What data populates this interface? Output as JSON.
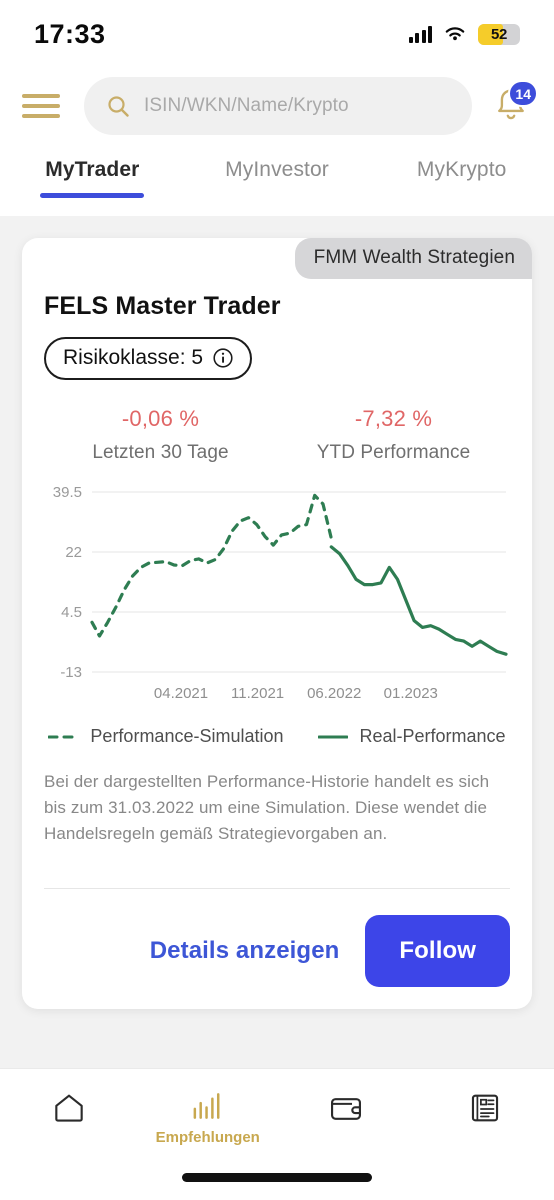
{
  "status_bar": {
    "time": "17:33",
    "signal_icon": "cellular-signal-icon",
    "wifi_icon": "wifi-icon",
    "battery_level": "52",
    "battery_color": "#f5cc2a"
  },
  "header": {
    "menu_icon": "hamburger-menu-icon",
    "menu_color": "#c8ad68",
    "search": {
      "icon": "search-icon",
      "placeholder": "ISIN/WKN/Name/Krypto",
      "value": ""
    },
    "notifications": {
      "icon": "bell-icon",
      "badge_count": "14",
      "badge_color": "#3d4ddb"
    }
  },
  "tabs": {
    "active_index": 0,
    "accent_color": "#3d4ddb",
    "items": [
      {
        "label": "MyTrader"
      },
      {
        "label": "MyInvestor"
      },
      {
        "label": "MyKrypto"
      }
    ]
  },
  "card": {
    "provider_badge": "FMM Wealth Strategien",
    "title": "FELS Master Trader",
    "risk": {
      "label": "Risikoklasse: 5",
      "info_icon": "info-circle-icon"
    },
    "stats": [
      {
        "value": "-0,06 %",
        "label": "Letzten 30 Tage",
        "color": "#e06666"
      },
      {
        "value": "-7,32 %",
        "label": "YTD Performance",
        "color": "#e06666"
      }
    ],
    "legend": [
      {
        "label": "Performance-Simulation",
        "style": "dashed",
        "color": "#2e7d52"
      },
      {
        "label": "Real-Performance",
        "style": "solid",
        "color": "#2e7d52"
      }
    ],
    "disclaimer": "Bei der dargestellten Performance-Historie handelt es sich bis zum 31.03.2022 um eine Simulation. Diese wendet die Handelsregeln gemäß Strategievorgaben an.",
    "details_link": "Details anzeigen",
    "follow_button": "Follow"
  },
  "chart_data": {
    "type": "line",
    "title": "",
    "xlabel": "",
    "ylabel": "",
    "ylim": [
      -13,
      39.5
    ],
    "yticks": [
      39.5,
      22,
      4.5,
      -13
    ],
    "ytick_labels": [
      "39.5",
      "22",
      "4.5",
      "-13"
    ],
    "xticks": [
      0.215,
      0.4,
      0.585,
      0.77
    ],
    "xtick_labels": [
      "04.2021",
      "11.2021",
      "06.2022",
      "01.2023"
    ],
    "grid": true,
    "legend_position": "bottom",
    "series": [
      {
        "name": "Performance-Simulation",
        "style": "dashed",
        "color": "#2e7d52",
        "x": [
          0.0,
          0.018,
          0.038,
          0.058,
          0.078,
          0.098,
          0.118,
          0.138,
          0.158,
          0.178,
          0.198,
          0.218,
          0.238,
          0.258,
          0.278,
          0.298,
          0.318,
          0.338,
          0.358,
          0.378,
          0.398,
          0.418,
          0.438,
          0.458,
          0.478,
          0.498,
          0.518,
          0.538,
          0.558,
          0.578
        ],
        "y": [
          1.5,
          -2.5,
          1.5,
          6.0,
          11.0,
          15.0,
          17.5,
          18.8,
          19.0,
          19.2,
          18.2,
          18.0,
          19.5,
          20.0,
          18.8,
          19.8,
          23.0,
          28.0,
          31.0,
          32.0,
          30.0,
          26.5,
          24.0,
          27.0,
          27.5,
          29.5,
          30.0,
          38.5,
          36.0,
          26.0
        ]
      },
      {
        "name": "Real-Performance",
        "style": "solid",
        "color": "#2e7d52",
        "x": [
          0.578,
          0.598,
          0.618,
          0.638,
          0.658,
          0.678,
          0.698,
          0.718,
          0.738,
          0.758,
          0.778,
          0.798,
          0.818,
          0.838,
          0.858,
          0.878,
          0.898,
          0.918,
          0.938,
          0.958,
          0.978,
          1.0
        ],
        "y": [
          23.5,
          21.5,
          18.0,
          14.0,
          12.5,
          12.5,
          13.0,
          17.5,
          14.0,
          8.0,
          2.0,
          0.0,
          0.5,
          -0.5,
          -2.0,
          -3.5,
          -4.0,
          -5.5,
          -4.0,
          -5.5,
          -7.0,
          -7.8
        ]
      }
    ]
  },
  "bottom_nav": {
    "active_index": 1,
    "active_color": "#c8a84f",
    "items": [
      {
        "icon": "home-icon",
        "label": ""
      },
      {
        "icon": "bar-chart-icon",
        "label": "Empfehlungen"
      },
      {
        "icon": "wallet-icon",
        "label": ""
      },
      {
        "icon": "news-icon",
        "label": ""
      }
    ]
  }
}
